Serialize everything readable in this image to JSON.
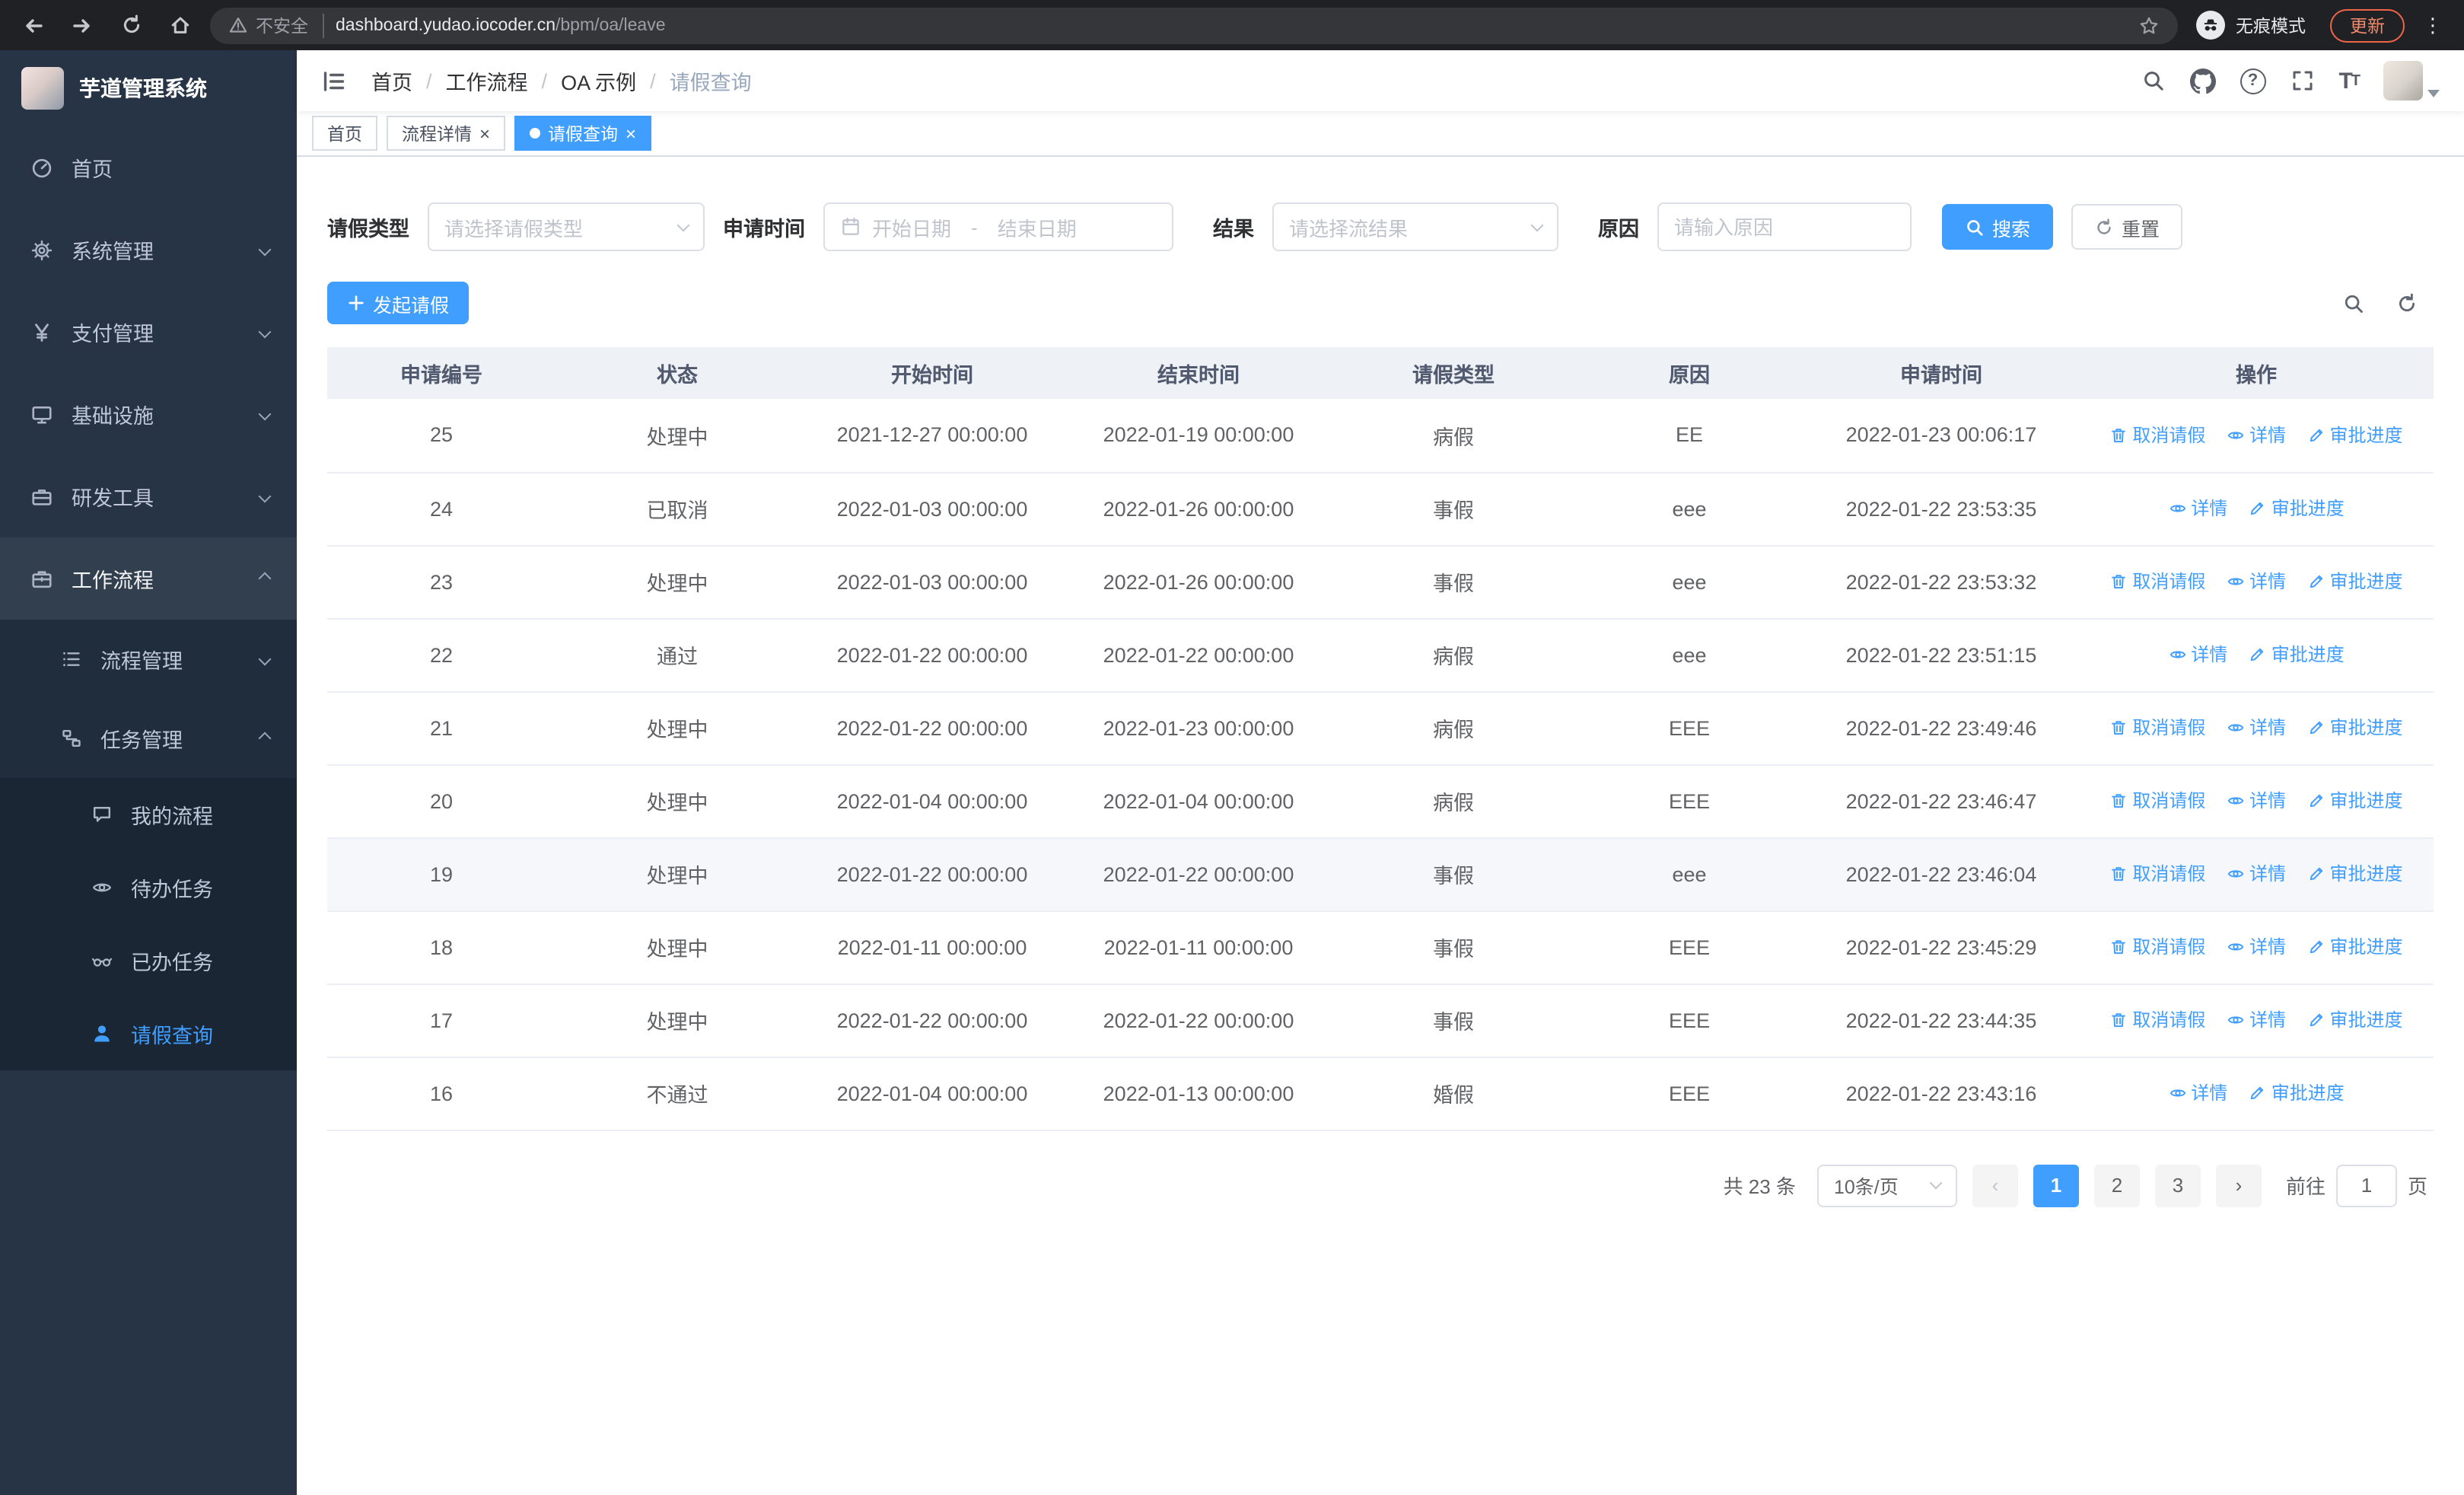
{
  "browser": {
    "security_text": "不安全",
    "url_host": "dashboard.yudao.iocoder.cn",
    "url_path": "/bpm/oa/leave",
    "incognito_label": "无痕模式",
    "update_label": "更新"
  },
  "sidebar": {
    "title": "芋道管理系统",
    "items": [
      {
        "label": "首页"
      },
      {
        "label": "系统管理"
      },
      {
        "label": "支付管理"
      },
      {
        "label": "基础设施"
      },
      {
        "label": "研发工具"
      },
      {
        "label": "工作流程"
      }
    ],
    "workflow_children": [
      {
        "label": "流程管理"
      },
      {
        "label": "任务管理"
      }
    ],
    "task_children": [
      {
        "label": "我的流程"
      },
      {
        "label": "待办任务"
      },
      {
        "label": "已办任务"
      },
      {
        "label": "请假查询"
      }
    ]
  },
  "navbar": {
    "breadcrumb": [
      "首页",
      "工作流程",
      "OA 示例",
      "请假查询"
    ]
  },
  "tabs": [
    {
      "label": "首页"
    },
    {
      "label": "流程详情"
    },
    {
      "label": "请假查询"
    }
  ],
  "filters": {
    "leave_type_label": "请假类型",
    "leave_type_placeholder": "请选择请假类型",
    "apply_time_label": "申请时间",
    "start_date_placeholder": "开始日期",
    "range_separator": "-",
    "end_date_placeholder": "结束日期",
    "result_label": "结果",
    "result_placeholder": "请选择流结果",
    "reason_label": "原因",
    "reason_placeholder": "请输入原因",
    "search_button": "搜索",
    "reset_button": "重置"
  },
  "toolbar": {
    "create_button": "发起请假"
  },
  "table": {
    "columns": [
      "申请编号",
      "状态",
      "开始时间",
      "结束时间",
      "请假类型",
      "原因",
      "申请时间",
      "操作"
    ],
    "actions": {
      "cancel": "取消请假",
      "detail": "详情",
      "progress": "审批进度"
    },
    "rows": [
      {
        "id": "25",
        "status": "处理中",
        "start": "2021-12-27 00:00:00",
        "end": "2022-01-19 00:00:00",
        "type": "病假",
        "reason": "EE",
        "applied": "2022-01-23 00:06:17",
        "can_cancel": true
      },
      {
        "id": "24",
        "status": "已取消",
        "start": "2022-01-03 00:00:00",
        "end": "2022-01-26 00:00:00",
        "type": "事假",
        "reason": "eee",
        "applied": "2022-01-22 23:53:35",
        "can_cancel": false
      },
      {
        "id": "23",
        "status": "处理中",
        "start": "2022-01-03 00:00:00",
        "end": "2022-01-26 00:00:00",
        "type": "事假",
        "reason": "eee",
        "applied": "2022-01-22 23:53:32",
        "can_cancel": true
      },
      {
        "id": "22",
        "status": "通过",
        "start": "2022-01-22 00:00:00",
        "end": "2022-01-22 00:00:00",
        "type": "病假",
        "reason": "eee",
        "applied": "2022-01-22 23:51:15",
        "can_cancel": false
      },
      {
        "id": "21",
        "status": "处理中",
        "start": "2022-01-22 00:00:00",
        "end": "2022-01-23 00:00:00",
        "type": "病假",
        "reason": "EEE",
        "applied": "2022-01-22 23:49:46",
        "can_cancel": true
      },
      {
        "id": "20",
        "status": "处理中",
        "start": "2022-01-04 00:00:00",
        "end": "2022-01-04 00:00:00",
        "type": "病假",
        "reason": "EEE",
        "applied": "2022-01-22 23:46:47",
        "can_cancel": true
      },
      {
        "id": "19",
        "status": "处理中",
        "start": "2022-01-22 00:00:00",
        "end": "2022-01-22 00:00:00",
        "type": "事假",
        "reason": "eee",
        "applied": "2022-01-22 23:46:04",
        "can_cancel": true,
        "highlighted": true
      },
      {
        "id": "18",
        "status": "处理中",
        "start": "2022-01-11 00:00:00",
        "end": "2022-01-11 00:00:00",
        "type": "事假",
        "reason": "EEE",
        "applied": "2022-01-22 23:45:29",
        "can_cancel": true
      },
      {
        "id": "17",
        "status": "处理中",
        "start": "2022-01-22 00:00:00",
        "end": "2022-01-22 00:00:00",
        "type": "事假",
        "reason": "EEE",
        "applied": "2022-01-22 23:44:35",
        "can_cancel": true
      },
      {
        "id": "16",
        "status": "不通过",
        "start": "2022-01-04 00:00:00",
        "end": "2022-01-13 00:00:00",
        "type": "婚假",
        "reason": "EEE",
        "applied": "2022-01-22 23:43:16",
        "can_cancel": false
      }
    ]
  },
  "pagination": {
    "total_text": "共 23 条",
    "page_size": "10条/页",
    "pages": [
      "1",
      "2",
      "3"
    ],
    "goto_label": "前往",
    "goto_value": "1",
    "goto_suffix": "页"
  },
  "colors": {
    "primary": "#409eff",
    "sidebar_active": "#409eff"
  }
}
